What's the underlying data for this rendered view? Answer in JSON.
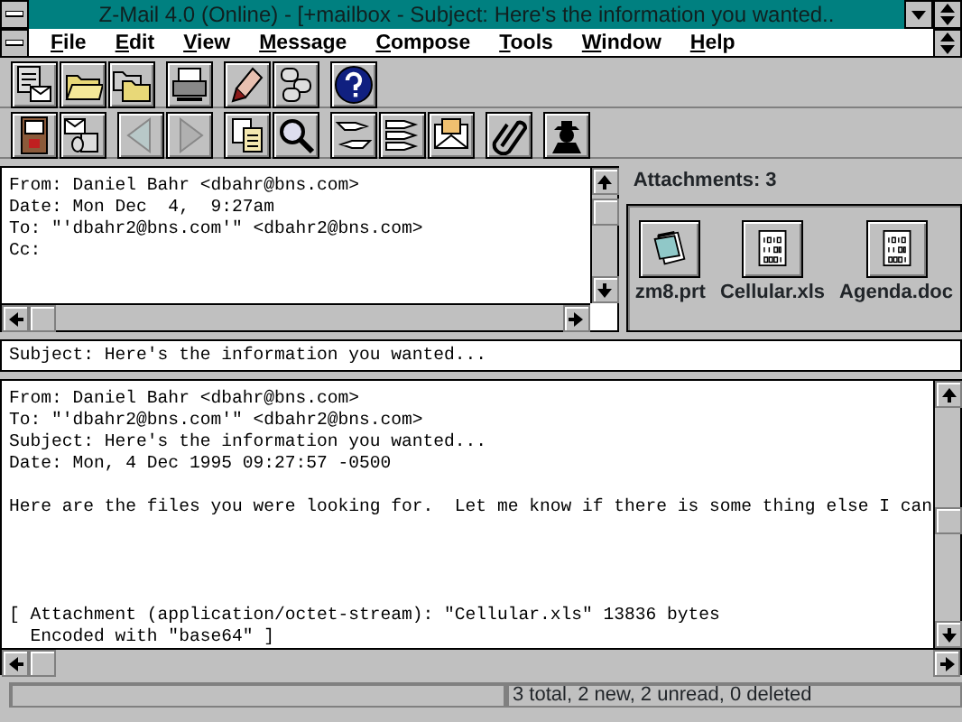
{
  "window": {
    "title": "Z-Mail 4.0 (Online) - [+mailbox - Subject: Here's the information you wanted.."
  },
  "menu": [
    "File",
    "Edit",
    "View",
    "Message",
    "Compose",
    "Tools",
    "Window",
    "Help"
  ],
  "header_pane": {
    "lines": [
      "From: Daniel Bahr <dbahr@bns.com>",
      "Date: Mon Dec  4,  9:27am",
      "To: \"'dbahr2@bns.com'\" <dbahr2@bns.com>",
      "Cc:"
    ]
  },
  "attachments": {
    "label": "Attachments: 3",
    "items": [
      {
        "name": "zm8.prt",
        "kind": "document"
      },
      {
        "name": "Cellular.xls",
        "kind": "binary"
      },
      {
        "name": "Agenda.doc",
        "kind": "binary"
      }
    ]
  },
  "subject_line": "Subject: Here's the information you wanted...",
  "body": {
    "blocks": [
      {
        "lines": [
          "From: Daniel Bahr <dbahr@bns.com>",
          "To: \"'dbahr2@bns.com'\" <dbahr2@bns.com>",
          "Subject: Here's the information you wanted...",
          "Date: Mon, 4 Dec 1995 09:27:57 -0500"
        ]
      },
      {
        "lines": [
          "Here are the files you were looking for.  Let me know if there is some thing else I can"
        ]
      },
      {
        "lines": [
          "[ Attachment (application/octet-stream): \"Cellular.xls\" 13836 bytes",
          "  Encoded with \"base64\" ]"
        ]
      }
    ]
  },
  "status_bar": "3 total, 2 new, 2 unread, 0 deleted"
}
